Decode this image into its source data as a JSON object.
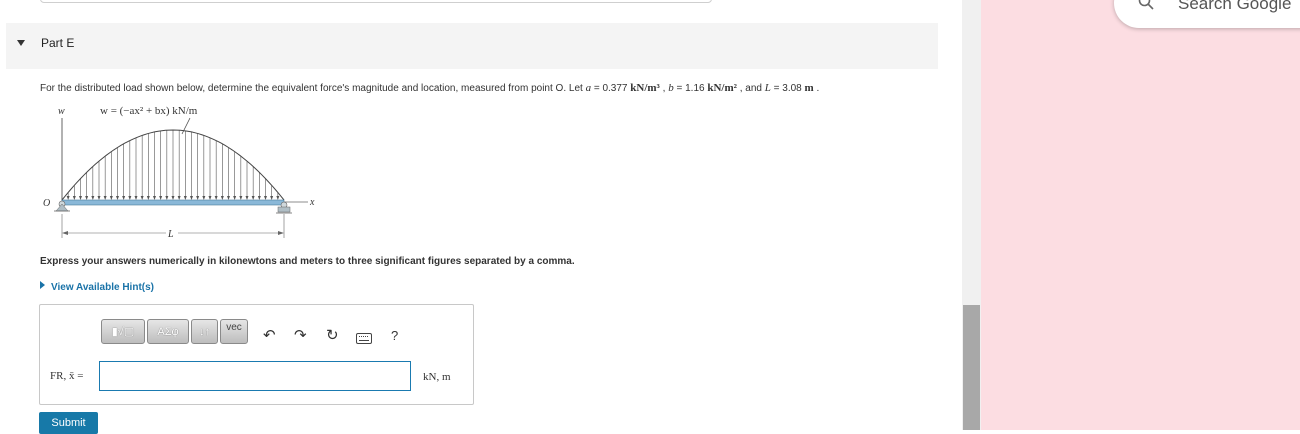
{
  "part": {
    "title": "Part E"
  },
  "problem": {
    "intro": "For the distributed load shown below, determine the equivalent force's magnitude and location, measured from point O. Let ",
    "a_sym": "a",
    "a_eq": " = 0.377 ",
    "a_unit": "kN/m³",
    "b_sep": " , ",
    "b_sym": "b",
    "b_eq": " = 1.16 ",
    "b_unit": "kN/m²",
    "l_sep": " , and ",
    "l_sym": "L",
    "l_eq": " = 3.08 ",
    "l_unit": "m",
    "end": " ."
  },
  "figure": {
    "w_axis_label": "w",
    "equation": "w = (−ax² + bx) kN/m",
    "origin_label": "O",
    "x_axis_label": "x",
    "length_label": "L"
  },
  "instructions": "Express your answers numerically in kilonewtons and meters to three significant figures separated by a comma.",
  "hint_link": "View Available Hint(s)",
  "toolbar": {
    "templates_label": "▮√▢",
    "greek_label": "ΑΣφ",
    "arrows_label": "↓↑",
    "vec_label": "vec",
    "undo_icon": "undo-icon",
    "redo_icon": "redo-icon",
    "reset_icon": "reset-icon",
    "keyboard_icon": "keyboard-icon",
    "help_label": "?"
  },
  "answer": {
    "label": "FR, x̄ =",
    "value": "",
    "unit": "kN, m"
  },
  "submit_label": "Submit",
  "browser_side": {
    "search_placeholder": "Search Google"
  },
  "colors": {
    "accent": "#1779a8",
    "side_panel": "#fcdde2",
    "header_bg": "#f4f4f4"
  }
}
